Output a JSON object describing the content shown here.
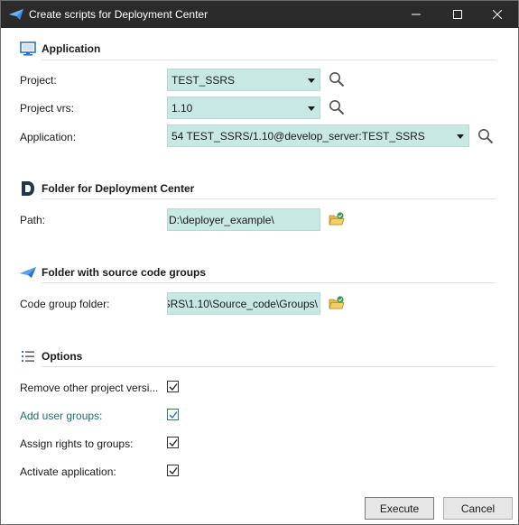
{
  "window": {
    "title": "Create scripts for Deployment Center",
    "icons": {
      "app": "send-arrow-icon",
      "minimize": "minimize-icon",
      "maximize": "maximize-icon",
      "close": "close-icon"
    }
  },
  "sections": {
    "application": {
      "title": "Application",
      "icon": "monitor-icon"
    },
    "deployment_folder": {
      "title": "Folder for Deployment Center",
      "icon": "deployment-d-icon"
    },
    "source_folder": {
      "title": "Folder with source code groups",
      "icon": "send-arrow-icon"
    },
    "options": {
      "title": "Options",
      "icon": "list-icon"
    }
  },
  "application": {
    "project_label": "Project:",
    "project_value": "TEST_SSRS",
    "project_vrs_label": "Project vrs:",
    "project_vrs_value": "1.10",
    "application_label": "Application:",
    "application_value": "54 TEST_SSRS/1.10@develop_server:TEST_SSRS"
  },
  "deployment_folder": {
    "path_label": "Path:",
    "path_value": "D:\\deployer_example\\"
  },
  "source_folder": {
    "code_group_label": "Code group folder:",
    "code_group_value": "SRS\\1.10\\Source_code\\Groups\\"
  },
  "options": {
    "items": [
      {
        "label": "Remove  other  project  versi...",
        "checked": true
      },
      {
        "label": "Add user groups:",
        "checked": true
      },
      {
        "label": "Assign rights to groups:",
        "checked": true
      },
      {
        "label": "Activate application:",
        "checked": true
      }
    ]
  },
  "buttons": {
    "execute": "Execute",
    "cancel": "Cancel"
  },
  "colors": {
    "titlebar": "#2b2b2b",
    "field_bg": "#c8e8e3",
    "accent_blue": "#2b73c6",
    "label_teal": "#1f6f6a"
  }
}
